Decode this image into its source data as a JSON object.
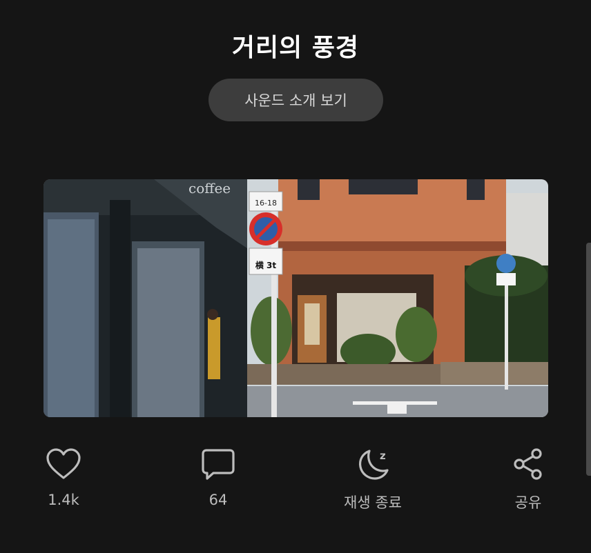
{
  "header": {
    "title": "거리의 풍경",
    "sound_intro_label": "사운드 소개 보기"
  },
  "media": {
    "sign_text": "横 3t",
    "sign_distance": "16-18",
    "shop_sign": "coffee"
  },
  "actions": {
    "like": {
      "icon": "heart-icon",
      "label": "1.4k"
    },
    "comment": {
      "icon": "comment-icon",
      "label": "64"
    },
    "sleep": {
      "icon": "moon-icon",
      "label": "재생 종료"
    },
    "share": {
      "icon": "share-icon",
      "label": "공유"
    }
  },
  "colors": {
    "background": "#151515",
    "button": "#3d3d3d",
    "icon": "#bdbdbd"
  }
}
